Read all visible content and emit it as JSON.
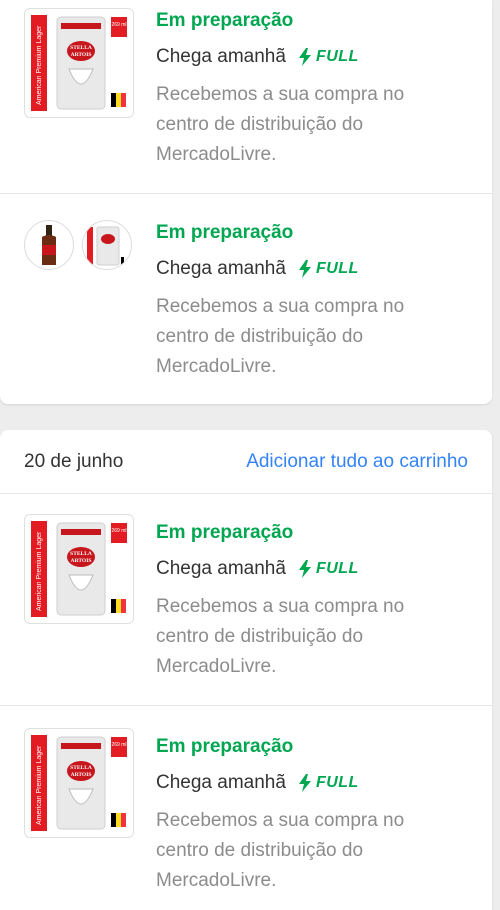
{
  "groups": [
    {
      "items": [
        {
          "status": "Em preparação",
          "arrival": "Chega amanhã",
          "badge": "FULL",
          "desc": "Recebemos a sua compra no centro de distribuição do MercadoLivre.",
          "product": {
            "vertical_label": "American Premium Lager",
            "brand_line1": "STELLA",
            "brand_line2": "ARTOIS",
            "volume": "269 ml"
          }
        },
        {
          "status": "Em preparação",
          "arrival": "Chega amanhã",
          "badge": "FULL",
          "desc": "Recebemos a sua compra no centro de distribuição do MercadoLivre."
        }
      ]
    },
    {
      "date": "20 de junho",
      "action": "Adicionar tudo ao carrinho",
      "items": [
        {
          "status": "Em preparação",
          "arrival": "Chega amanhã",
          "badge": "FULL",
          "desc": "Recebemos a sua compra no centro de distribuição do MercadoLivre.",
          "product": {
            "vertical_label": "American Premium Lager",
            "brand_line1": "STELLA",
            "brand_line2": "ARTOIS",
            "volume": "269 ml"
          }
        },
        {
          "status": "Em preparação",
          "arrival": "Chega amanhã",
          "badge": "FULL",
          "desc": "Recebemos a sua compra no centro de distribuição do MercadoLivre.",
          "product": {
            "vertical_label": "American Premium Lager",
            "brand_line1": "STELLA",
            "brand_line2": "ARTOIS",
            "volume": "269 ml"
          }
        }
      ]
    }
  ],
  "colors": {
    "status_green": "#00a650",
    "link_blue": "#3483fa",
    "muted": "#8c8c8c"
  }
}
